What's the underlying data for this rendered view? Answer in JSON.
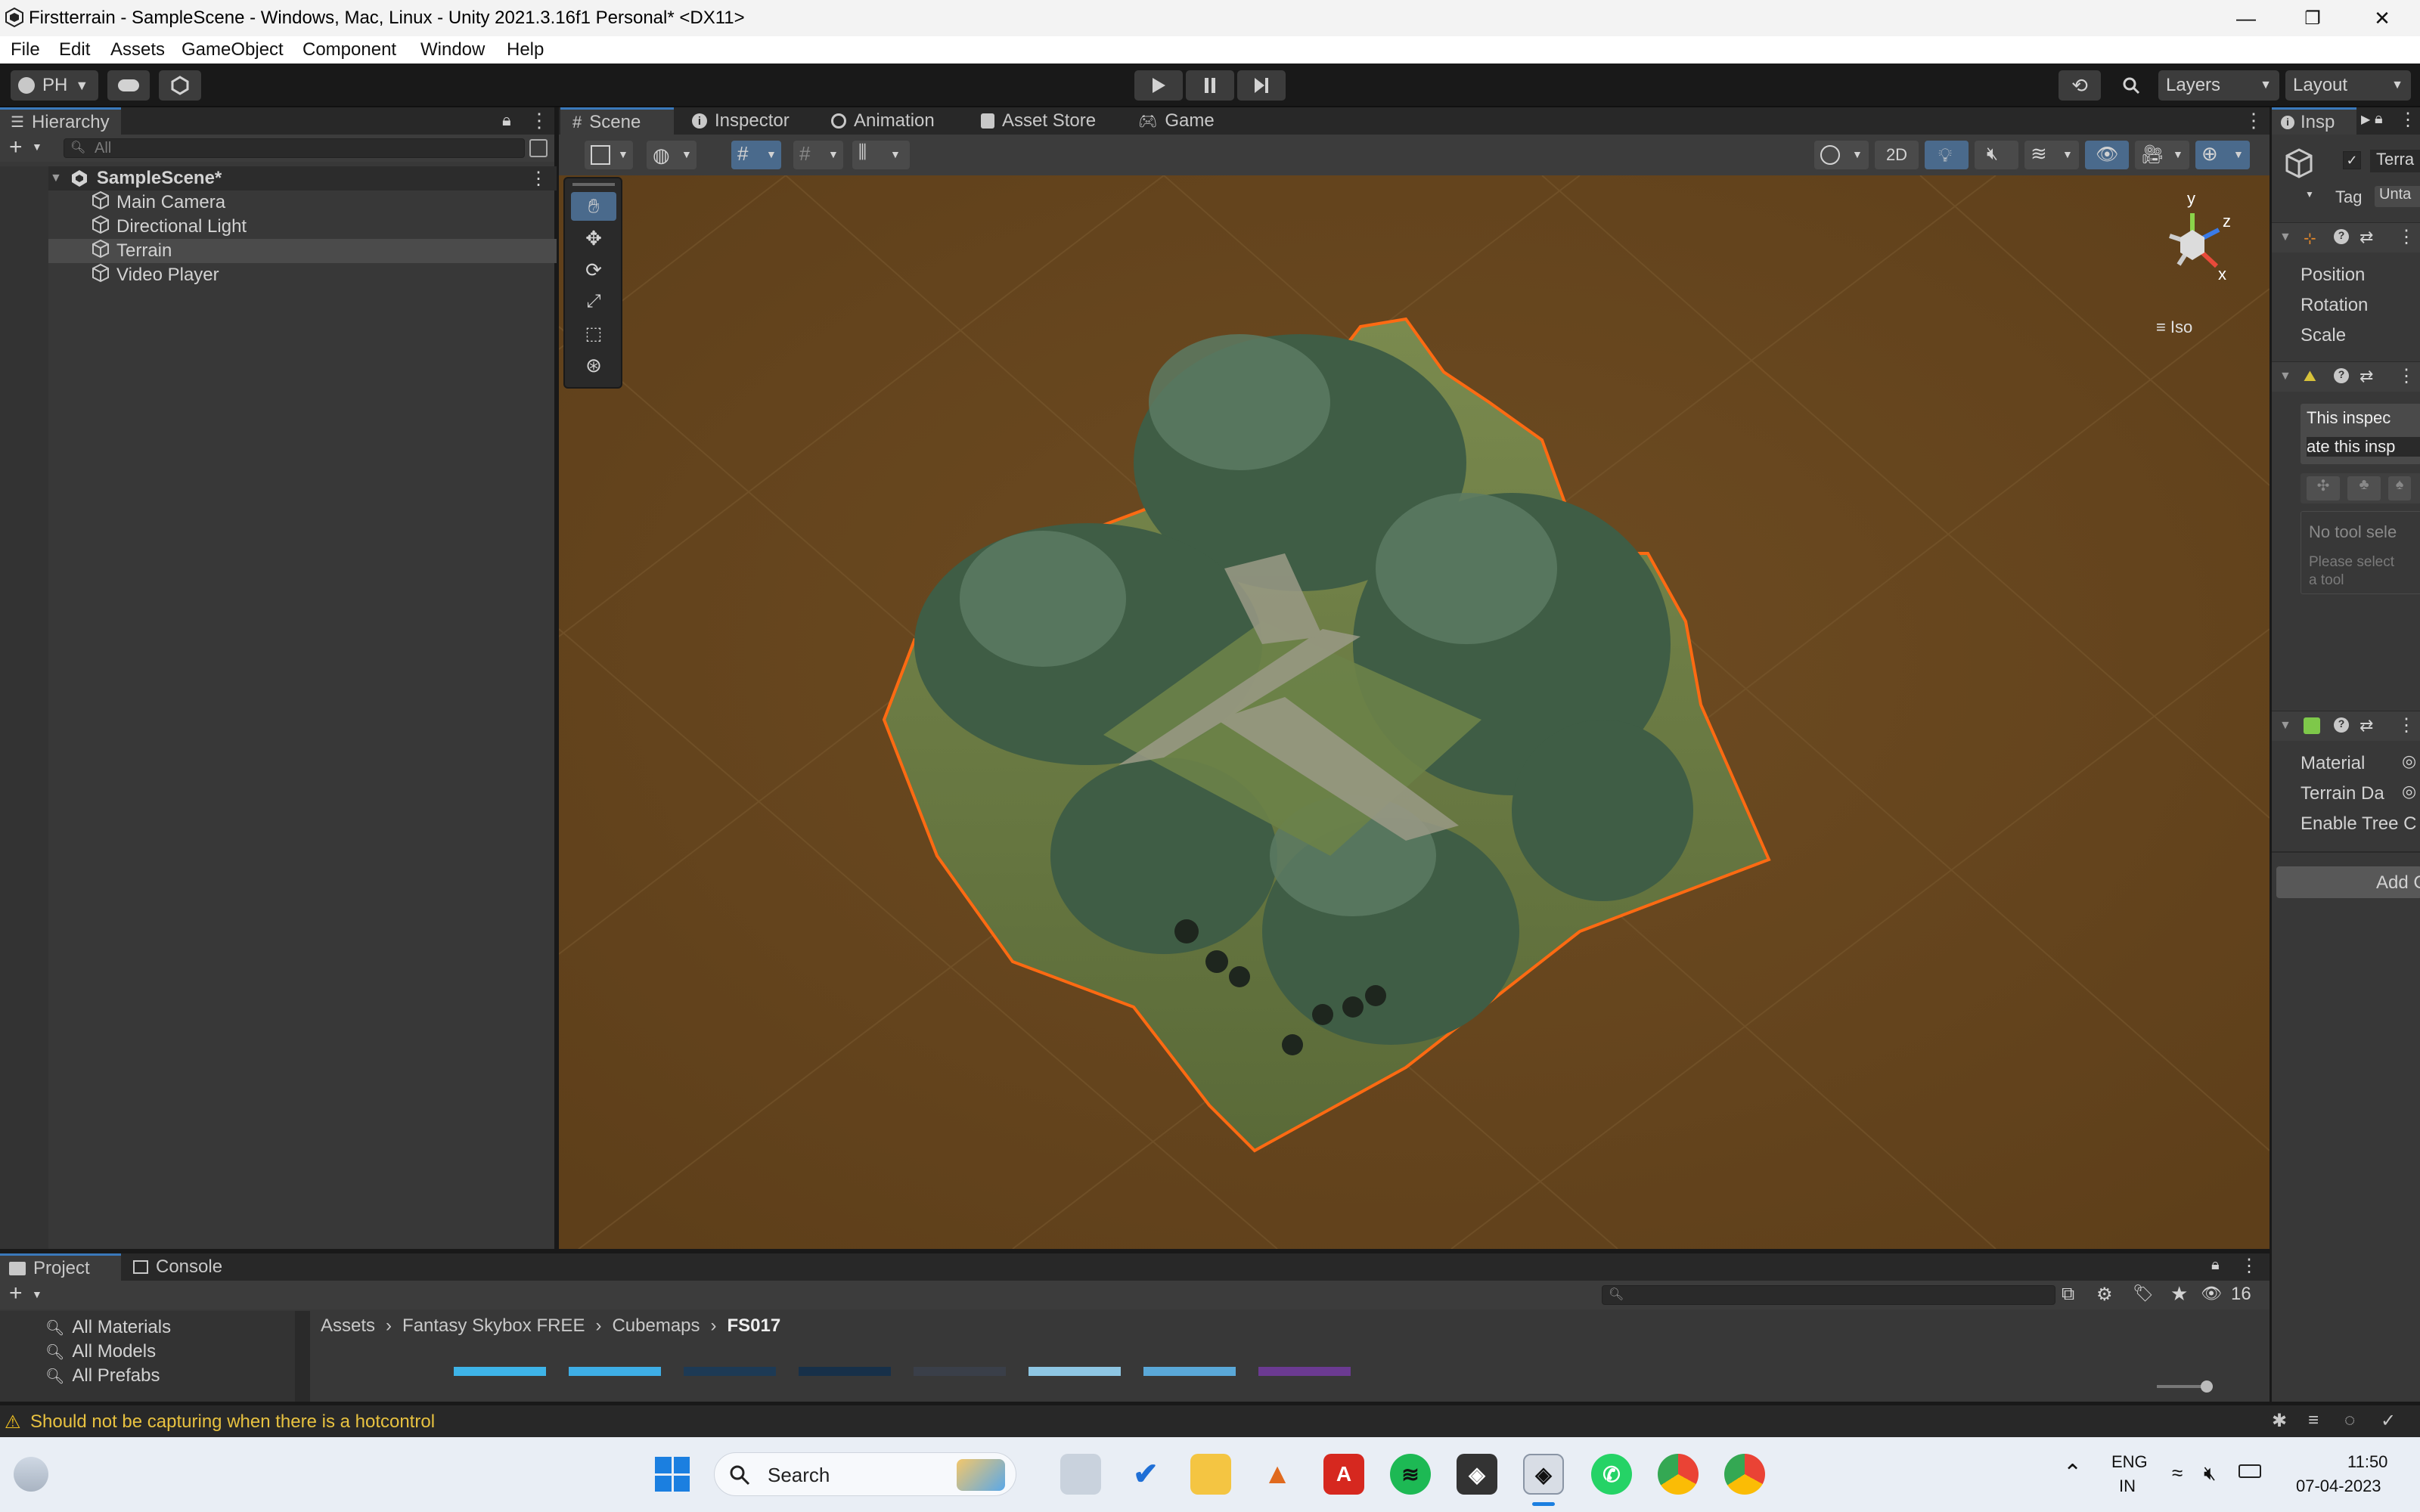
{
  "window": {
    "title": "Firstterrain - SampleScene - Windows, Mac, Linux - Unity 2021.3.16f1 Personal* <DX11>",
    "controls": [
      "—",
      "❐",
      "✕"
    ]
  },
  "menu": [
    "File",
    "Edit",
    "Assets",
    "GameObject",
    "Component",
    "Window",
    "Help"
  ],
  "toolbar": {
    "account_label": "PH",
    "play_icon": "play-icon",
    "pause_icon": "pause-icon",
    "step_icon": "step-icon",
    "layers_label": "Layers",
    "layout_label": "Layout"
  },
  "hierarchy": {
    "tab_label": "Hierarchy",
    "search_placeholder": "All",
    "scene_name": "SampleScene*",
    "items": [
      {
        "label": "Main Camera",
        "selected": false
      },
      {
        "label": "Directional Light",
        "selected": false
      },
      {
        "label": "Terrain",
        "selected": true
      },
      {
        "label": "Video Player",
        "selected": false
      }
    ]
  },
  "scene_tabs": [
    {
      "label": "Scene",
      "active": true,
      "icon": "grid-icon"
    },
    {
      "label": "Inspector",
      "active": false,
      "icon": "info-icon"
    },
    {
      "label": "Animation",
      "active": false,
      "icon": "animation-icon"
    },
    {
      "label": "Asset Store",
      "active": false,
      "icon": "store-icon"
    },
    {
      "label": "Game",
      "active": false,
      "icon": "gamepad-icon"
    }
  ],
  "scene": {
    "toggle_2d": "2D",
    "projection": "Iso",
    "gizmo_axes": {
      "y": "y",
      "z": "z",
      "x": "x"
    }
  },
  "inspector": {
    "tab_label": "Insp",
    "object_name": "Terra",
    "tag_label": "Tag",
    "tag_value": "Unta",
    "transform_fields": [
      "Position",
      "Rotation",
      "Scale"
    ],
    "terrain_msg1": "This inspec",
    "terrain_msg2": "ate this insp",
    "no_tool": "No tool sele",
    "please_select": "Please select",
    "a_tool": "a tool",
    "collider_fields": [
      "Material",
      "Terrain Da",
      "Enable Tree C"
    ],
    "add_component": "Add C"
  },
  "project": {
    "tabs": [
      {
        "label": "Project",
        "active": true
      },
      {
        "label": "Console",
        "active": false
      }
    ],
    "favorites": [
      "All Materials",
      "All Models",
      "All Prefabs"
    ],
    "breadcrumb": [
      "Assets",
      "Fantasy Skybox FREE",
      "Cubemaps",
      "FS017"
    ],
    "hidden_count": "16",
    "thumb_colors": [
      "#3eb4e8",
      "#3eaee6",
      "#1d3a55",
      "#173049",
      "#3a3f49",
      "#8ec6e3",
      "#5aa8d8",
      "#6b3a92"
    ]
  },
  "status": {
    "message": "Should not be capturing when there is a hotcontrol"
  },
  "taskbar": {
    "search_label": "Search",
    "lang_top": "ENG",
    "lang_bottom": "IN",
    "time": "11:50",
    "date": "07-04-2023"
  }
}
